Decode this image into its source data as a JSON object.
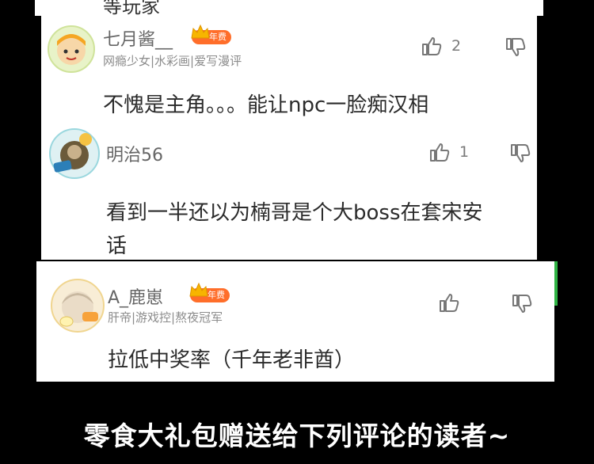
{
  "comments": [
    {
      "top_fragment": "等玩家",
      "username": "七月酱__",
      "badge": "年费",
      "tags": "网瘾少女|水彩画|爱写漫评",
      "likes": "2",
      "content": [
        "不愧是主角。。。能让npc一脸痴汉相"
      ]
    },
    {
      "username": "明治56",
      "likes": "1",
      "content": [
        "看到一半还以为楠哥是个大boss在套宋安",
        "话"
      ]
    },
    {
      "username": "A_鹿崽",
      "badge": "年费",
      "tags": "肝帝|游戏控|熬夜冠军",
      "likes": "",
      "content": [
        "拉低中奖率（千年老非酋）"
      ]
    }
  ],
  "promo_text": "零食大礼包赠送给下列评论的读者~",
  "colors": {
    "badge": "#ff6e2a",
    "edge": "#2fb344",
    "background": "#000000"
  }
}
